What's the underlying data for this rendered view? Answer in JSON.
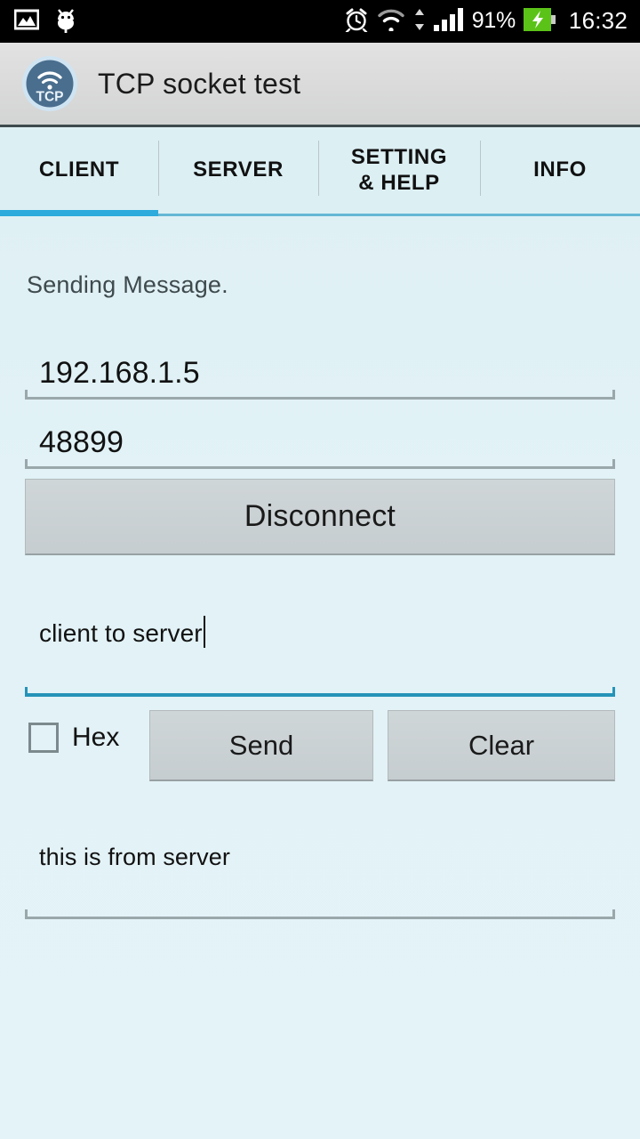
{
  "status_bar": {
    "icons_left": [
      "screenshot-icon",
      "android-debug-icon"
    ],
    "alarm_icon": "alarm-icon",
    "wifi_icon": "wifi-icon",
    "data-transfer_icon": "data-transfer-arrows-icon",
    "signal_icon": "cellular-signal-icon",
    "battery_percent": "91%",
    "battery_icon": "battery-charging-icon",
    "clock": "16:32"
  },
  "action_bar": {
    "app_icon": "tcp-wifi-app-icon",
    "app_icon_text": "TCP",
    "title": "TCP socket test"
  },
  "tabs": [
    {
      "label": "CLIENT",
      "active": true
    },
    {
      "label": "SERVER",
      "active": false
    },
    {
      "label": "SETTING\n& HELP",
      "line1": "SETTING",
      "line2": "& HELP",
      "active": false
    },
    {
      "label": "INFO",
      "active": false
    }
  ],
  "client": {
    "hint_sending": "Sending Message.",
    "ip_value": "192.168.1.5",
    "port_value": "48899",
    "connect_button": "Disconnect",
    "message_value": "client to server",
    "hex_label": "Hex",
    "hex_checked": false,
    "send_button": "Send",
    "clear_button": "Clear",
    "receive_value": "this is from server"
  },
  "colors": {
    "accent": "#2cabdc",
    "accent_inactive": "#64b8d4",
    "background": "#e2f2f6",
    "tabbar": "#dceff3",
    "actionbar": "#dadada",
    "button": "#c9d0d3",
    "battery_green": "#5bc318",
    "app_icon_blue": "#4a6e8e",
    "field_underline": "#9aa7ab",
    "field_underline_focused": "#2593b8"
  }
}
